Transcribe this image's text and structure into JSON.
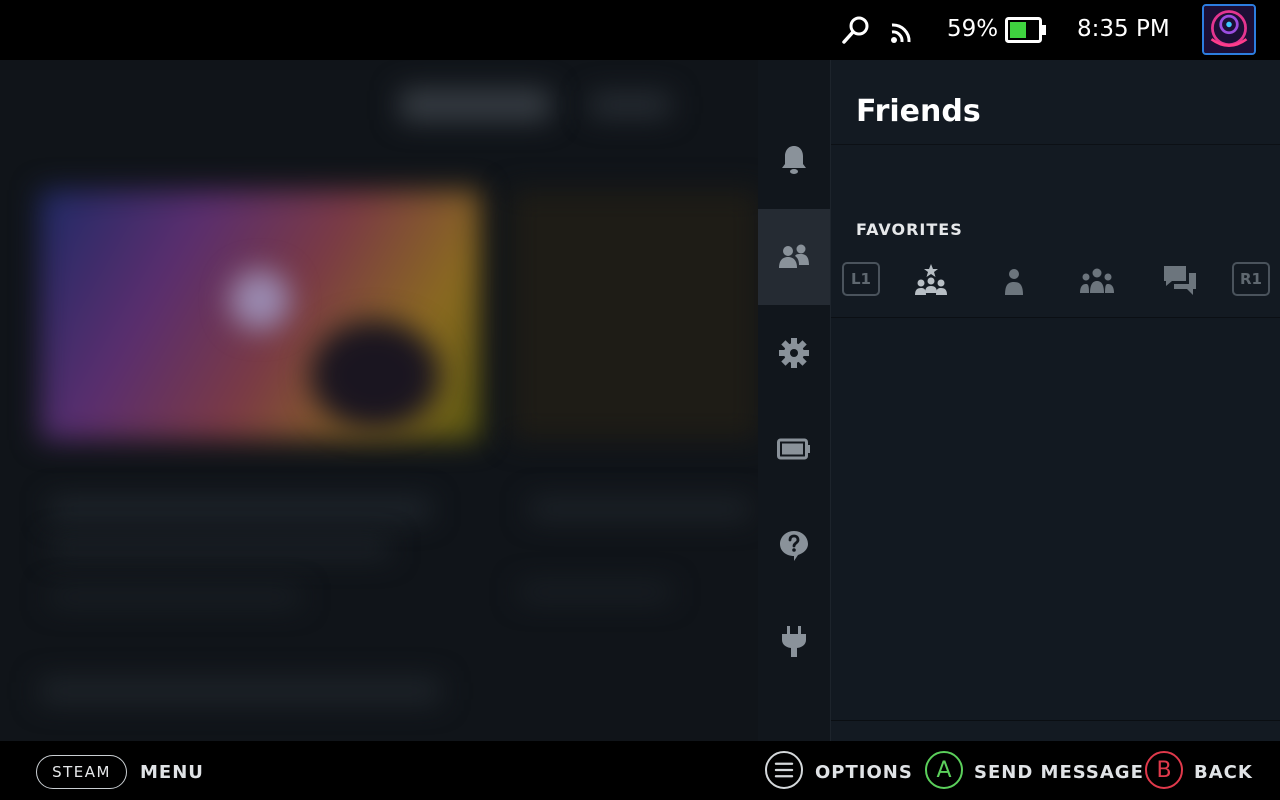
{
  "status_bar": {
    "battery_percent": "59%",
    "battery_level": 0.59,
    "time": "8:35 PM",
    "icons": [
      "search-icon",
      "signal-icon",
      "battery-icon"
    ]
  },
  "rail": {
    "items": [
      {
        "name": "notifications",
        "icon": "bell-icon"
      },
      {
        "name": "friends",
        "icon": "friends-icon",
        "active": true
      },
      {
        "name": "settings",
        "icon": "gear-icon"
      },
      {
        "name": "performance",
        "icon": "battery-rail-icon"
      },
      {
        "name": "help",
        "icon": "help-icon"
      },
      {
        "name": "plugins",
        "icon": "plug-icon"
      }
    ]
  },
  "panel": {
    "title": "Friends",
    "section_label": "FAVORITES",
    "tabs": {
      "left_bumper": "L1",
      "right_bumper": "R1",
      "items": [
        "favorites-friends-icon",
        "single-friend-icon",
        "group-icon",
        "chat-icon"
      ]
    }
  },
  "bottom_bar": {
    "steam_label": "STEAM",
    "menu_label": "MENU",
    "options_label": "OPTIONS",
    "a_button": "A",
    "send_message_label": "SEND MESSAGE",
    "b_button": "B",
    "back_label": "BACK"
  },
  "colors": {
    "a_button": "#5bcf5b",
    "b_button": "#e0394b",
    "battery_fill": "#3fd33f",
    "active_rail": "#252b33"
  }
}
